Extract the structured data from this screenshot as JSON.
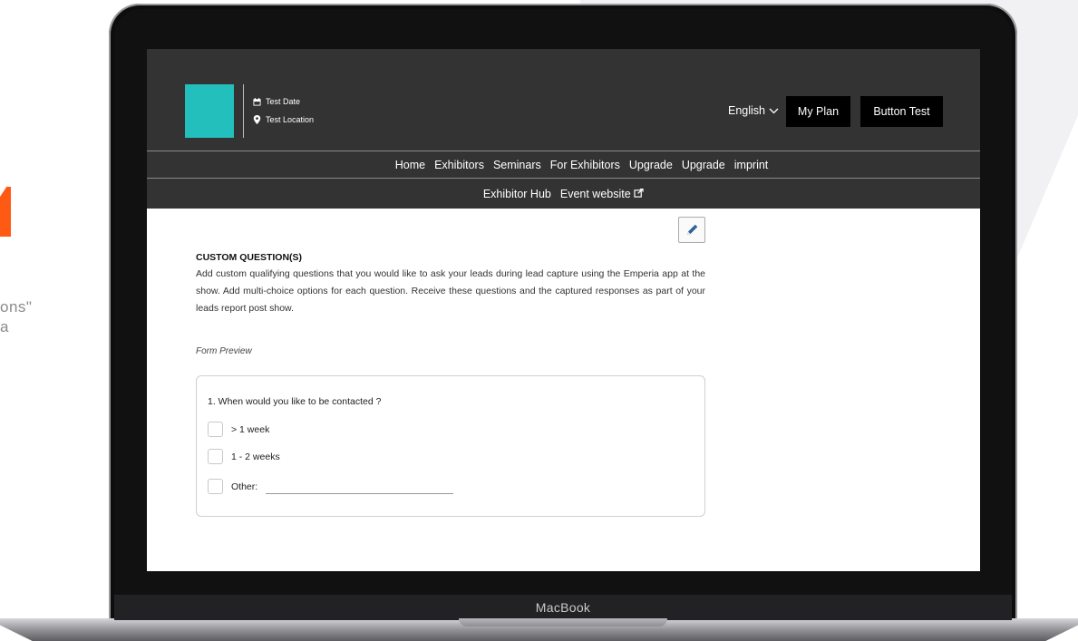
{
  "background": {
    "side_text_lines": [
      "ons\"",
      "a"
    ],
    "accent_color": "#ff5a14"
  },
  "laptop": {
    "bezel_label": "MacBook"
  },
  "header": {
    "logo_color": "#22bfbd",
    "event_date": "Test Date",
    "event_location": "Test Location",
    "language": "English",
    "my_plan_label": "My Plan",
    "button_test_label": "Button Test"
  },
  "nav": {
    "primary": [
      "Home",
      "Exhibitors",
      "Seminars",
      "For Exhibitors",
      "Upgrade",
      "Upgrade",
      "imprint"
    ],
    "secondary": [
      "Exhibitor Hub",
      "Event website"
    ]
  },
  "content": {
    "title": "CUSTOM QUESTION(S)",
    "description": "Add custom qualifying questions that you would like to ask your leads during lead capture using the Emperia app at the show. Add multi-choice options for each question. Receive these questions and the captured responses as part of your leads report post show.",
    "form_preview_label": "Form Preview",
    "question": "1. When would you like to be contacted ?",
    "options": [
      "> 1 week",
      "1 - 2 weeks",
      "Other:"
    ],
    "other_value": ""
  }
}
